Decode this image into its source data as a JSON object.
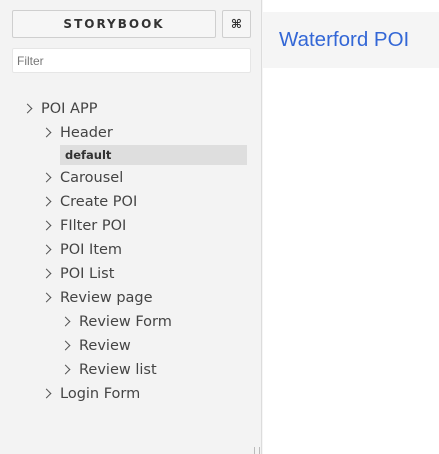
{
  "sidebar": {
    "brand_label": "STORYBOOK",
    "shortcut_label": "⌘",
    "filter_placeholder": "Filter",
    "tree": {
      "root": "POI APP",
      "header": "Header",
      "header_story": "default",
      "carousel": "Carousel",
      "create_poi": "Create POI",
      "filter_poi": "FIlter POI",
      "poi_item": "POI Item",
      "poi_list": "POI List",
      "review_page": "Review page",
      "review_form": "Review Form",
      "review": "Review",
      "review_list": "Review list",
      "login_form": "Login Form"
    }
  },
  "preview": {
    "title": "Waterford POI"
  },
  "colors": {
    "title": "#3367d6",
    "sidebar_bg": "#f3f3f3",
    "selected_bg": "#dedede"
  }
}
